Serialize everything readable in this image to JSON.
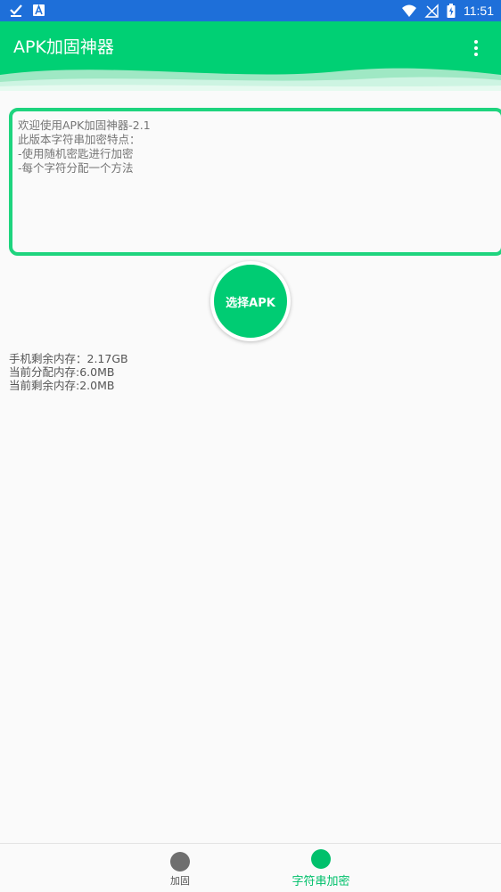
{
  "status_bar": {
    "time": "11:51",
    "icons": [
      "check-download-icon",
      "a-badge-icon",
      "wifi-icon",
      "no-signal-icon",
      "battery-icon"
    ]
  },
  "app_bar": {
    "title": "APK加固神器",
    "menu_icon": "overflow-menu-icon"
  },
  "info_box": {
    "lines": [
      "欢迎使用APK加固神器-2.1",
      "此版本字符串加密特点：",
      "-使用随机密匙进行加密",
      "-每个字符分配一个方法"
    ]
  },
  "select_button": {
    "label": "选择APK"
  },
  "memory": {
    "lines": [
      "手机剩余内存：2.17GB",
      "当前分配内存:6.0MB",
      "当前剩余内存:2.0MB"
    ]
  },
  "bottom_nav": {
    "items": [
      {
        "label": "加固",
        "active": false,
        "icon": "circle-icon"
      },
      {
        "label": "字符串加密",
        "active": true,
        "icon": "circle-icon"
      }
    ]
  },
  "colors": {
    "status_bar": "#1e6fd9",
    "primary": "#00d074",
    "accent_border": "#1ed47e",
    "active_nav": "#00c06b",
    "inactive_nav": "#6f6f6f"
  }
}
